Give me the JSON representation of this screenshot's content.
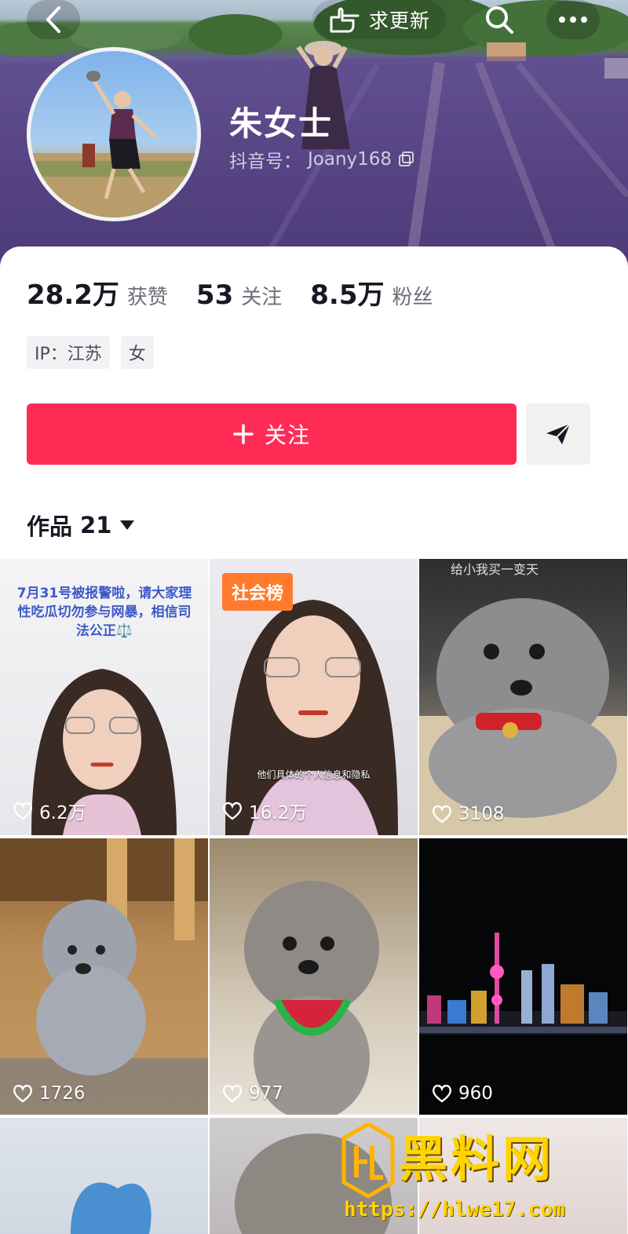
{
  "header": {
    "update_label": "求更新",
    "name": "朱女士",
    "uid_label": "抖音号：",
    "uid_value": "Joany168"
  },
  "stats": [
    {
      "value": "28.2万",
      "label": "获赞"
    },
    {
      "value": "53",
      "label": "关注"
    },
    {
      "value": "8.5万",
      "label": "粉丝"
    }
  ],
  "tags": [
    "IP：江苏",
    "女"
  ],
  "actions": {
    "follow_label": "关注"
  },
  "works_tab": {
    "label": "作品",
    "count": "21"
  },
  "videos": [
    {
      "likes": "6.2万",
      "overlay": "7月31号被报警啦，请大家理性吃瓜切勿参与网暴，相信司法公正⚖️"
    },
    {
      "likes": "16.2万",
      "badge": "社会榜",
      "caption": "他们具体的个人信息和隐私"
    },
    {
      "likes": "3108",
      "handwriting": "给小我买一变天"
    },
    {
      "likes": "1726"
    },
    {
      "likes": "977"
    },
    {
      "likes": "960"
    }
  ],
  "watermark": {
    "title": "黑料网",
    "url": "https://hlwe17.com"
  },
  "colors": {
    "accent": "#fe2c55",
    "badge": "#ff7a2c"
  }
}
